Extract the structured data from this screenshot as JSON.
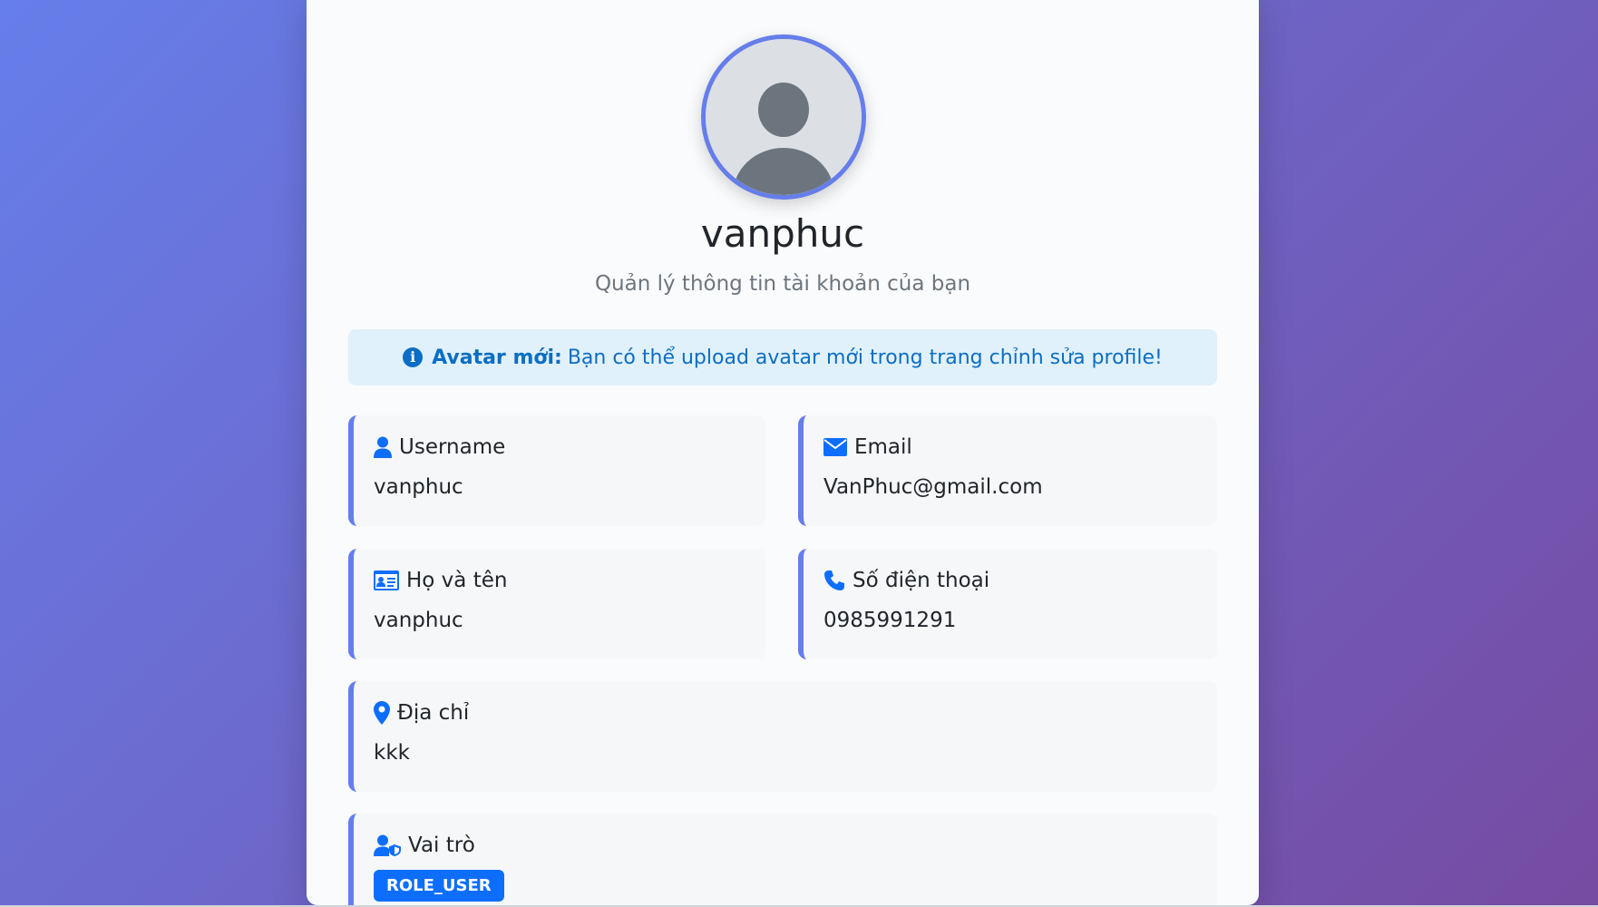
{
  "profile": {
    "name": "vanphuc",
    "subtitle": "Quản lý thông tin tài khoản của bạn"
  },
  "alert": {
    "icon": "info-circle-icon",
    "strong": "Avatar mới:",
    "message": "Bạn có thể upload avatar mới trong trang chỉnh sửa profile!"
  },
  "fields": {
    "username": {
      "label": "Username",
      "value": "vanphuc",
      "icon": "user-icon"
    },
    "email": {
      "label": "Email",
      "value": "VanPhuc@gmail.com",
      "icon": "envelope-icon"
    },
    "fullname": {
      "label": "Họ và tên",
      "value": "vanphuc",
      "icon": "id-card-icon"
    },
    "phone": {
      "label": "Số điện thoại",
      "value": "0985991291",
      "icon": "phone-icon"
    },
    "address": {
      "label": "Địa chỉ",
      "value": "kkk",
      "icon": "map-marker-icon"
    },
    "role": {
      "label": "Vai trò",
      "value": "ROLE_USER",
      "icon": "user-shield-icon"
    }
  },
  "colors": {
    "accent": "#667eea",
    "gradient_end": "#764ba2",
    "icon_blue": "#0d6efd",
    "alert_bg": "#e1f1fb",
    "alert_text": "#0b6ec4"
  }
}
